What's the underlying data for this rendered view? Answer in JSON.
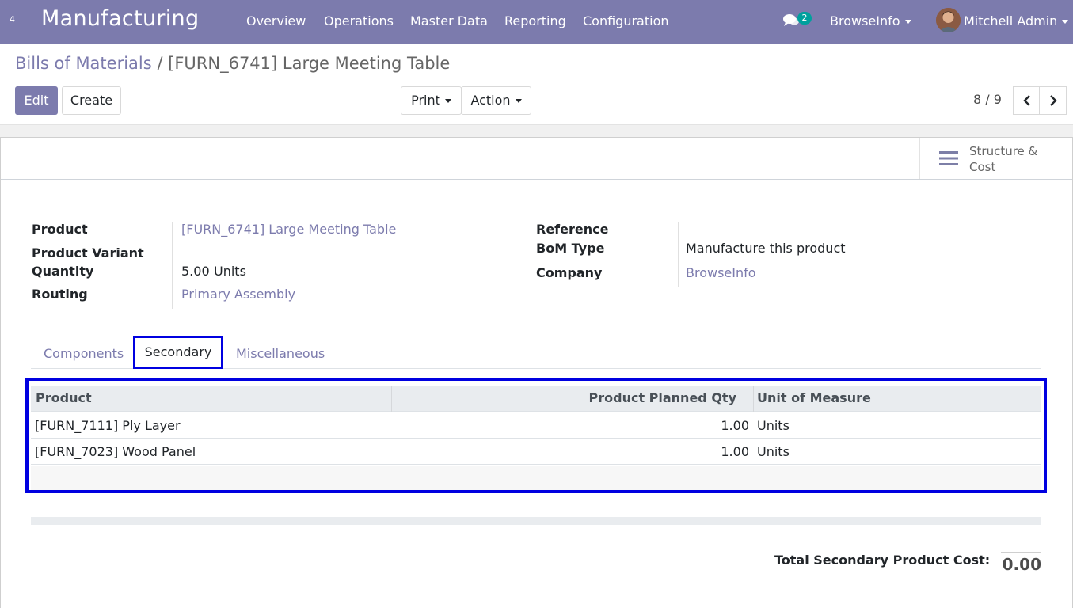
{
  "navbar": {
    "apps_badge": "4",
    "brand": "Manufacturing",
    "menu": [
      "Overview",
      "Operations",
      "Master Data",
      "Reporting",
      "Configuration"
    ],
    "chat_count": "2",
    "company": "BrowseInfo",
    "user": "Mitchell Admin"
  },
  "breadcrumb": {
    "parent": "Bills of Materials",
    "separator": " / ",
    "current": "[FURN_6741] Large Meeting Table"
  },
  "toolbar": {
    "edit_label": "Edit",
    "create_label": "Create",
    "print_label": "Print",
    "action_label": "Action"
  },
  "pager": {
    "value": "8 / 9"
  },
  "smart_button": {
    "label": "Structure & Cost"
  },
  "form": {
    "product_label": "Product",
    "product_value": "[FURN_6741] Large Meeting Table",
    "variant_label": "Product Variant",
    "quantity_label": "Quantity",
    "quantity_value": "5.00",
    "quantity_uom": "Units",
    "routing_label": "Routing",
    "routing_value": "Primary Assembly",
    "reference_label": "Reference",
    "bom_type_label": "BoM Type",
    "bom_type_value": "Manufacture this product",
    "company_label": "Company",
    "company_value": "BrowseInfo"
  },
  "tabs": [
    {
      "label": "Components"
    },
    {
      "label": "Secondary"
    },
    {
      "label": "Miscellaneous"
    }
  ],
  "table": {
    "headers": [
      "Product",
      "Product Planned Qty",
      "Unit of Measure"
    ],
    "rows": [
      {
        "product": "[FURN_7111] Ply Layer",
        "qty": "1.00",
        "uom": "Units"
      },
      {
        "product": "[FURN_7023] Wood Panel",
        "qty": "1.00",
        "uom": "Units"
      }
    ]
  },
  "total": {
    "label": "Total Secondary Product Cost:",
    "value": "0.00"
  },
  "colors": {
    "brand": "#7c7bad",
    "highlight": "#0000e0",
    "badge": "#00a09d"
  }
}
